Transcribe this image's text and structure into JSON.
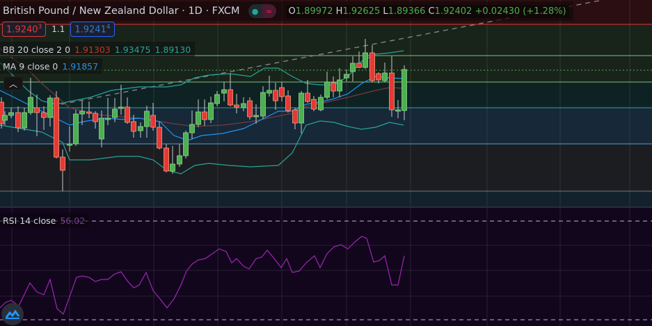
{
  "header": {
    "title": "British Pound / New Zealand Dollar · 1D · FXCM",
    "toggle_icons": [
      "dot-icon",
      "wave-icon"
    ],
    "ohlc": {
      "o_label": "O",
      "o": "1.89972",
      "h_label": "H",
      "h": "1.92625",
      "l_label": "L",
      "l": "1.89366",
      "c_label": "C",
      "c": "1.92402",
      "change": "+0.02430 (+1.28%)"
    }
  },
  "trade": {
    "sell_price": "1.9240",
    "sell_small": "3",
    "spread": "1.1",
    "buy_price": "1.9241",
    "buy_small": "4"
  },
  "indicators": {
    "bb": {
      "label": "BB 20 close 2 0",
      "basis": "1.91303",
      "upper": "1.93475",
      "lower": "1.89130"
    },
    "ma": {
      "label": "MA 9 close 0",
      "value": "1.91857"
    },
    "rsi": {
      "label": "RSI 14 close",
      "value": "56.02"
    }
  },
  "colors": {
    "up": "#4caf50",
    "down": "#e53935",
    "bb_basis": "#c0392b",
    "bb_band": "#26a69a",
    "ma": "#2196f3",
    "rsi": "#9c27b0"
  }
}
